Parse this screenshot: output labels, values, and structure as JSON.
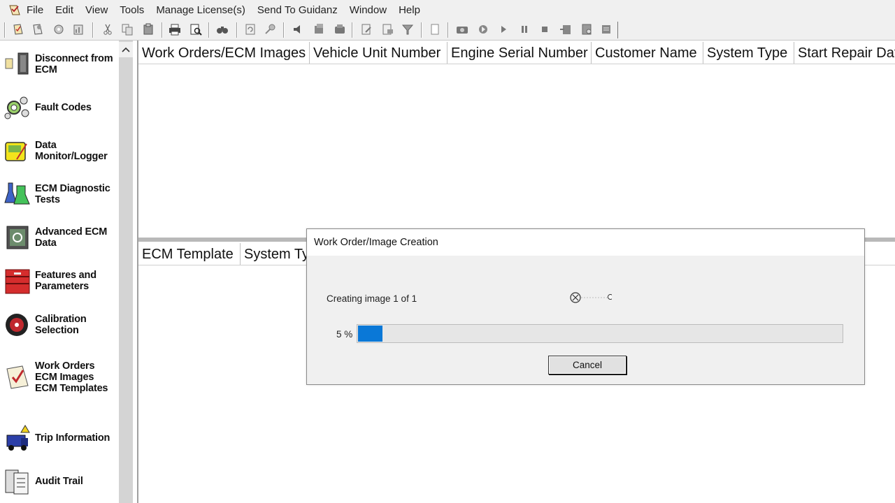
{
  "menu": [
    "File",
    "Edit",
    "View",
    "Tools",
    "Manage License(s)",
    "Send To Guidanz",
    "Window",
    "Help"
  ],
  "sidebar": {
    "items": [
      {
        "label": "Disconnect from ECM",
        "icon": "disconnect-icon"
      },
      {
        "label": "Fault Codes",
        "icon": "fault-codes-icon"
      },
      {
        "label": "Data Monitor/Logger",
        "icon": "data-monitor-icon"
      },
      {
        "label": "ECM Diagnostic Tests",
        "icon": "diagnostic-flask-icon"
      },
      {
        "label": "Advanced ECM Data",
        "icon": "advanced-ecm-icon"
      },
      {
        "label": "Features and Parameters",
        "icon": "features-toolbox-icon"
      },
      {
        "label": "Calibration Selection",
        "icon": "calibration-disc-icon"
      },
      {
        "label": "Work Orders ECM Images ECM Templates",
        "icon": "work-orders-checklist-icon"
      },
      {
        "label": "Trip Information",
        "icon": "truck-icon"
      },
      {
        "label": "Audit Trail",
        "icon": "audit-trail-icon"
      }
    ]
  },
  "grid_top": {
    "columns": [
      "Work Orders/ECM Images",
      "Vehicle Unit Number",
      "Engine Serial Number",
      "Customer Name",
      "System Type",
      "Start Repair Dat"
    ]
  },
  "grid_bottom": {
    "columns": [
      "ECM Template",
      "System Ty"
    ]
  },
  "dialog": {
    "title": "Work Order/Image Creation",
    "status": "Creating image 1 of 1",
    "percent_label": "5 %",
    "progress": 0.05,
    "cancel_label": "Cancel"
  },
  "colors": {
    "progress_fill": "#0a78d7",
    "chrome": "#f0f0f0"
  }
}
